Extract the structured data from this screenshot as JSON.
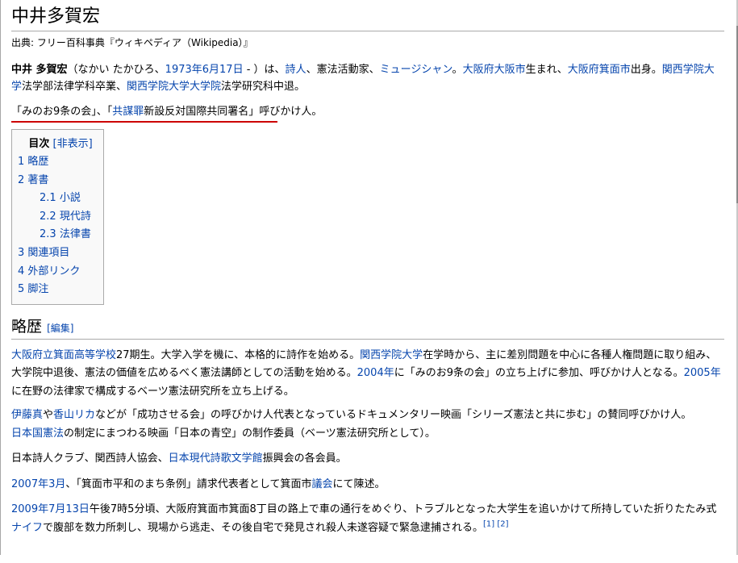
{
  "title": "中井多賀宏",
  "source_line": "出典: フリー百科事典『ウィキペディア（Wikipedia）』",
  "intro": {
    "name_bold": "中井 多賀宏",
    "reading": "（なかい たかひろ、",
    "birth_link": "1973年6月17日",
    "after_birth": " - ）は、",
    "link_poet": "詩人",
    "t_activist": "、憲法活動家、",
    "link_musician": "ミュージシャン",
    "t_1": "。",
    "link_osaka_city": "大阪府大阪市",
    "t_2": "生まれ、",
    "link_minoh": "大阪府箕面市",
    "t_3": "出身。",
    "link_kwansei1": "関西学院大学",
    "t_4": "法学部法律学科卒業、",
    "link_kwansei2": "関西学院大学大学院",
    "t_5": "法学研究科中退。"
  },
  "callout": {
    "t_open": "「みのお9条の会」、「",
    "link_kyobozai": "共謀罪",
    "t_rest": "新設反対国際共同署名」",
    "t_end": "呼びかけ人。"
  },
  "toc": {
    "heading": "目次",
    "toggle": "[非表示]",
    "items": [
      {
        "num": "1",
        "label": "略歴"
      },
      {
        "num": "2",
        "label": "著書"
      },
      {
        "num": "2.1",
        "label": "小説"
      },
      {
        "num": "2.2",
        "label": "現代詩"
      },
      {
        "num": "2.3",
        "label": "法律書"
      },
      {
        "num": "3",
        "label": "関連項目"
      },
      {
        "num": "4",
        "label": "外部リンク"
      },
      {
        "num": "5",
        "label": "脚注"
      }
    ]
  },
  "section_history": {
    "heading": "略歴",
    "edit": "[編集]"
  },
  "history": {
    "p1": {
      "link_school": "大阪府立箕面高等学校",
      "t_1": "27期生。大学入学を機に、本格的に詩作を始める。",
      "link_kwansei": "関西学院大学",
      "t_2": "在学時から、主に差別問題を中心に各種人権問題に取り組み、大学院中退後、憲法の価値を広めるべく憲法講師としての活動を始める。",
      "link_2004": "2004年",
      "t_3": "に「みのお9条の会」の立ち上げに参加、呼びかけ人となる。",
      "link_2005": "2005年",
      "t_4": "に在野の法律家で構成するベーツ憲法研究所を立ち上げる。"
    },
    "p2": {
      "link_ito": "伊藤真",
      "t_1": "や",
      "link_kayama": "香山リカ",
      "t_2": "などが「成功させる会」の呼びかけ人代表となっているドキュメンタリー映画「シリーズ憲法と共に歩む」の賛同呼びかけ人。",
      "link_constitution": "日本国憲法",
      "t_3": "の制定にまつわる映画「日本の青空」の制作委員（ベーツ憲法研究所として）。"
    },
    "p3": {
      "t_1": "日本詩人クラブ、関西詩人協会、",
      "link_museum": "日本現代詩歌文学館",
      "t_2": "振興会の各会員。"
    },
    "p4": {
      "link_date": "2007年3月",
      "t_1": "、「箕面市平和のまち条例」請求代表者として箕面市",
      "link_council": "議会",
      "t_2": "にて陳述。"
    },
    "p5": {
      "link_date": "2009年7月13日",
      "t_1": "午後7時5分頃、大阪府箕面市箕面8丁目の路上で車の通行をめぐり、トラブルとなった大学生を追いかけて所持していた折りたたみ式",
      "link_knife": "ナイフ",
      "t_2": "で腹部を数力所刺し、現場から逃走、その後自宅で発見され殺人未遂容疑で緊急逮捕される。",
      "ref1": "[1]",
      "ref2": "[2]"
    }
  },
  "colors": {
    "link": "#0645ad",
    "rule": "#aaaaaa",
    "toc_bg": "#f9f9f9",
    "red_underline": "#cc0000"
  }
}
